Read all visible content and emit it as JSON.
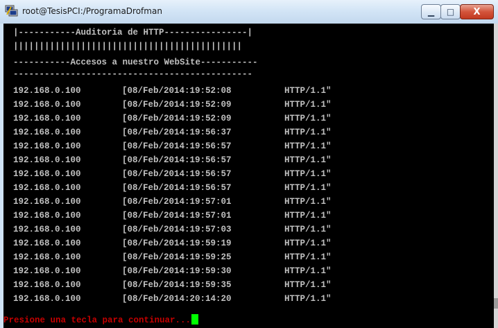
{
  "window": {
    "title": "root@TesisPCI:/ProgramaDrofman",
    "icon": "putty-terminal-icon",
    "controls": {
      "minimize": "▁",
      "maximize": "□",
      "close": "X"
    },
    "colors": {
      "terminal_background": "#000000",
      "terminal_text": "#c0c0c0",
      "prompt_text": "#c40000",
      "cursor": "#00ff00"
    }
  },
  "terminal": {
    "header_lines": [
      "|-----------Auditoria de HTTP----------------|",
      "||||||||||||||||||||||||||||||||||||||||||||",
      "-----------Accesos a nuestro WebSite-----------",
      "----------------------------------------------"
    ],
    "columns": [
      "ip",
      "timestamp",
      "protocol"
    ],
    "rows": [
      {
        "ip": "192.168.0.100",
        "timestamp": "[08/Feb/2014:19:52:08",
        "protocol": "HTTP/1.1\""
      },
      {
        "ip": "192.168.0.100",
        "timestamp": "[08/Feb/2014:19:52:09",
        "protocol": "HTTP/1.1\""
      },
      {
        "ip": "192.168.0.100",
        "timestamp": "[08/Feb/2014:19:52:09",
        "protocol": "HTTP/1.1\""
      },
      {
        "ip": "192.168.0.100",
        "timestamp": "[08/Feb/2014:19:56:37",
        "protocol": "HTTP/1.1\""
      },
      {
        "ip": "192.168.0.100",
        "timestamp": "[08/Feb/2014:19:56:57",
        "protocol": "HTTP/1.1\""
      },
      {
        "ip": "192.168.0.100",
        "timestamp": "[08/Feb/2014:19:56:57",
        "protocol": "HTTP/1.1\""
      },
      {
        "ip": "192.168.0.100",
        "timestamp": "[08/Feb/2014:19:56:57",
        "protocol": "HTTP/1.1\""
      },
      {
        "ip": "192.168.0.100",
        "timestamp": "[08/Feb/2014:19:56:57",
        "protocol": "HTTP/1.1\""
      },
      {
        "ip": "192.168.0.100",
        "timestamp": "[08/Feb/2014:19:57:01",
        "protocol": "HTTP/1.1\""
      },
      {
        "ip": "192.168.0.100",
        "timestamp": "[08/Feb/2014:19:57:01",
        "protocol": "HTTP/1.1\""
      },
      {
        "ip": "192.168.0.100",
        "timestamp": "[08/Feb/2014:19:57:03",
        "protocol": "HTTP/1.1\""
      },
      {
        "ip": "192.168.0.100",
        "timestamp": "[08/Feb/2014:19:59:19",
        "protocol": "HTTP/1.1\""
      },
      {
        "ip": "192.168.0.100",
        "timestamp": "[08/Feb/2014:19:59:25",
        "protocol": "HTTP/1.1\""
      },
      {
        "ip": "192.168.0.100",
        "timestamp": "[08/Feb/2014:19:59:30",
        "protocol": "HTTP/1.1\""
      },
      {
        "ip": "192.168.0.100",
        "timestamp": "[08/Feb/2014:19:59:35",
        "protocol": "HTTP/1.1\""
      },
      {
        "ip": "192.168.0.100",
        "timestamp": "[08/Feb/2014:20:14:20",
        "protocol": "HTTP/1.1\""
      }
    ],
    "prompt": "Presione una tecla para continuar..."
  }
}
